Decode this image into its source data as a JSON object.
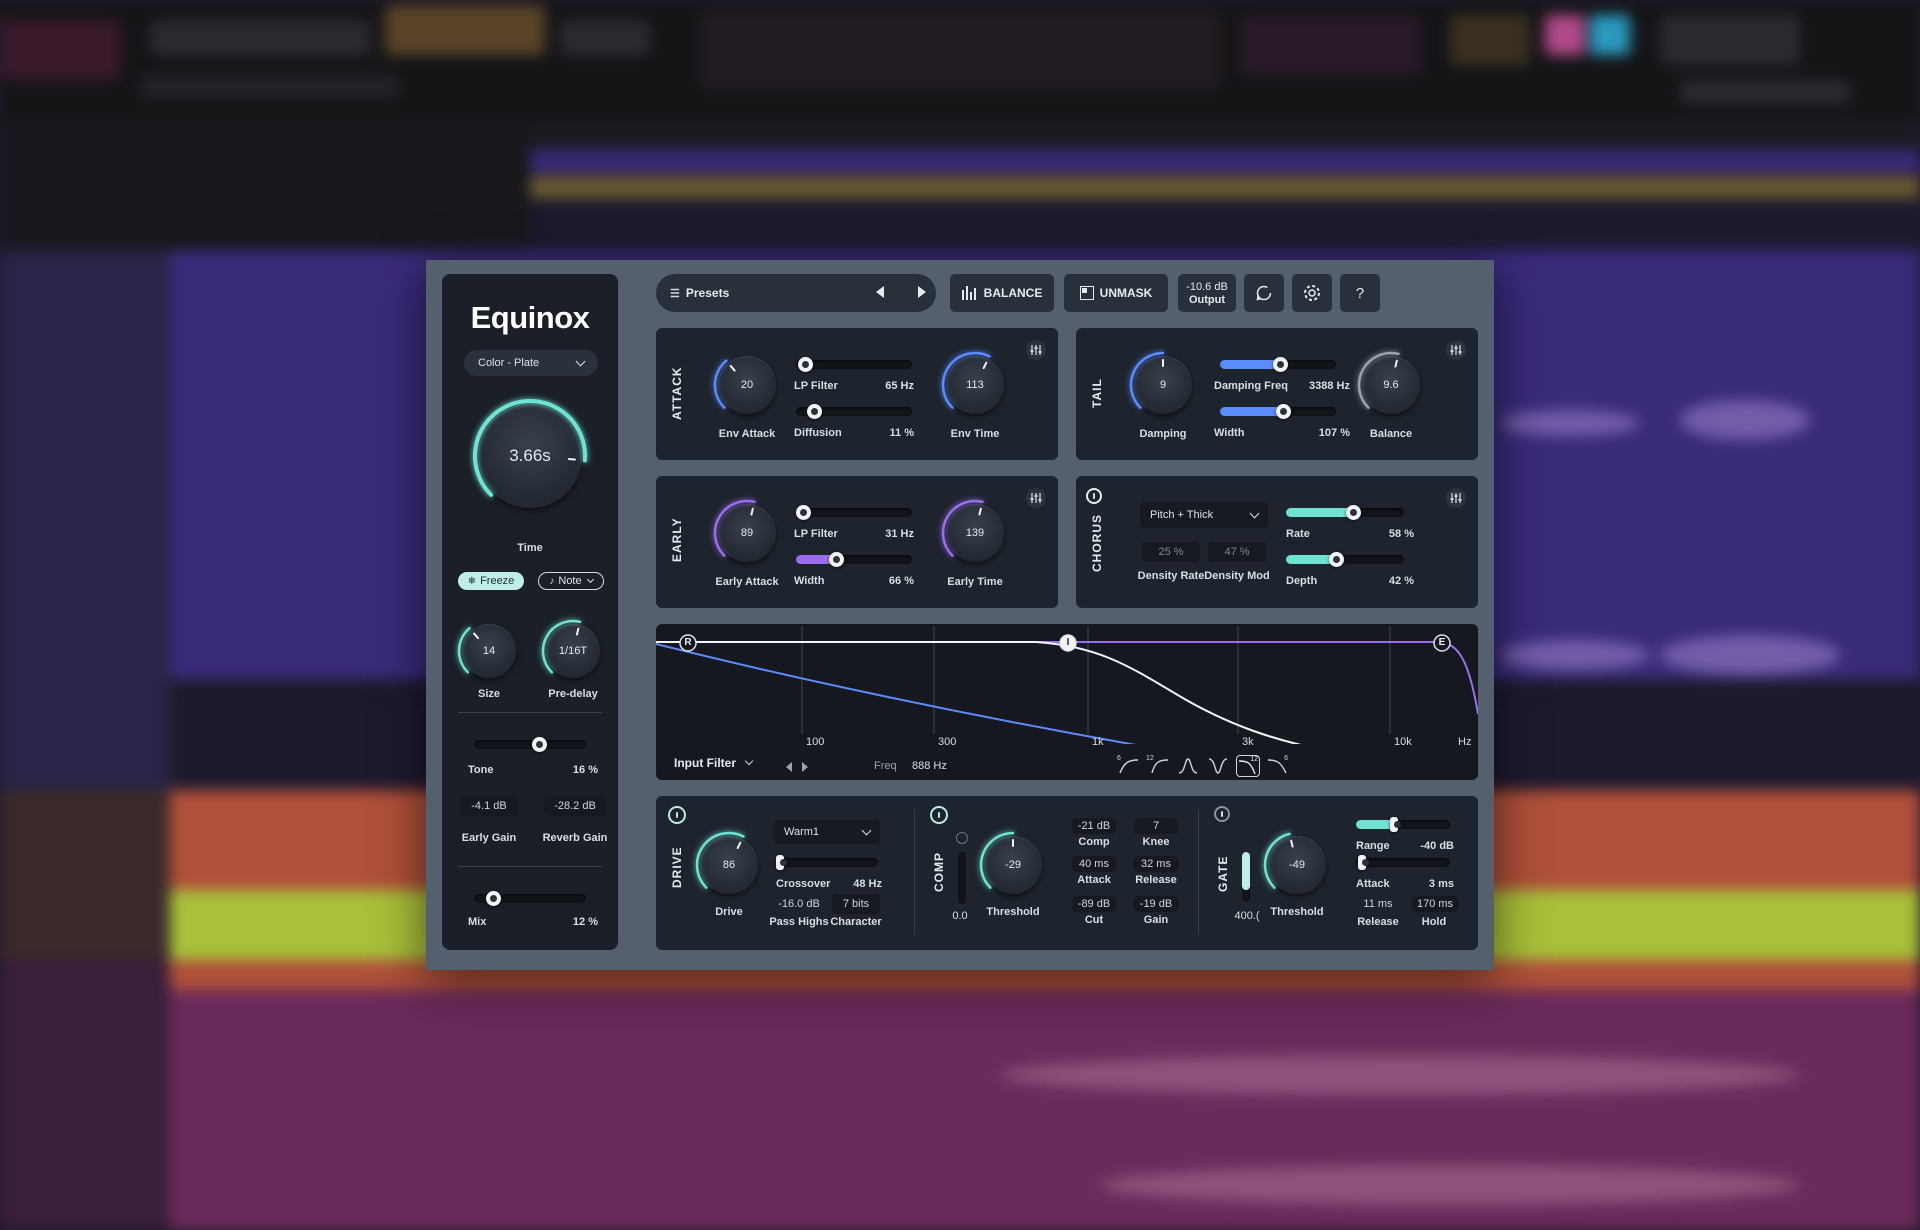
{
  "plugin": {
    "brand": "Equinox",
    "colors": {
      "accent_teal": "#6fe3d2",
      "accent_purple": "#9a6cf0",
      "accent_blue": "#5b8cff",
      "panel": "#1e242d"
    },
    "left": {
      "preset_type": "Color - Plate",
      "time": {
        "value": "3.66s",
        "label": "Time",
        "level": 0.85
      },
      "freeze_label": "Freeze",
      "note_label": "Note",
      "size": {
        "value": "14",
        "label": "Size",
        "level": 0.35
      },
      "predelay": {
        "value": "1/16T",
        "label": "Pre-delay",
        "level": 0.55
      },
      "tone": {
        "label": "Tone",
        "value": "16 %",
        "level": 0.6
      },
      "early_gain": {
        "value": "-4.1 dB",
        "label": "Early Gain"
      },
      "reverb_gain": {
        "value": "-28.2 dB",
        "label": "Reverb Gain"
      },
      "mix": {
        "label": "Mix",
        "value": "12 %",
        "level": 0.12
      }
    },
    "toolbar": {
      "presets_label": "Presets",
      "balance_label": "BALANCE",
      "unmask_label": "UNMASK",
      "output_value": "-10.6 dB",
      "output_label": "Output"
    },
    "attack": {
      "title": "ATTACK",
      "env_attack": {
        "value": "20",
        "label": "Env Attack",
        "level": 0.35
      },
      "lp_filter": {
        "label": "LP Filter",
        "value": "65 Hz",
        "level": 0.02
      },
      "diffusion": {
        "label": "Diffusion",
        "value": "11 %",
        "level": 0.11
      },
      "env_time": {
        "value": "113",
        "label": "Env Time",
        "level": 0.6
      }
    },
    "tail": {
      "title": "TAIL",
      "damping": {
        "value": "9",
        "label": "Damping",
        "level": 0.5
      },
      "damping_freq": {
        "label": "Damping Freq",
        "value": "3388 Hz",
        "level": 0.52
      },
      "width": {
        "label": "Width",
        "value": "107 %",
        "level": 0.55
      },
      "balance": {
        "value": "9.6",
        "label": "Balance",
        "level": 0.55
      }
    },
    "early": {
      "title": "EARLY",
      "early_attack": {
        "value": "89",
        "label": "Early Attack",
        "level": 0.55
      },
      "lp_filter": {
        "label": "LP Filter",
        "value": "31 Hz",
        "level": 0.0
      },
      "width": {
        "label": "Width",
        "value": "66 %",
        "level": 0.33
      },
      "early_time": {
        "value": "139",
        "label": "Early Time",
        "level": 0.55
      }
    },
    "chorus": {
      "title": "CHORUS",
      "mode": "Pitch + Thick",
      "density_rate": {
        "value": "25 %",
        "label": "Density Rate"
      },
      "density_mod": {
        "value": "47 %",
        "label": "Density Mod"
      },
      "rate": {
        "label": "Rate",
        "value": "58 %",
        "level": 0.58
      },
      "depth": {
        "label": "Depth",
        "value": "42 %",
        "level": 0.42
      }
    },
    "filter": {
      "nodes": [
        "R",
        "I",
        "E"
      ],
      "freq_ticks": [
        "100",
        "300",
        "1k",
        "3k",
        "10k",
        "Hz"
      ],
      "selector": "Input Filter",
      "freq_label": "Freq",
      "freq_value": "888 Hz",
      "shape_icons": [
        "6",
        "12",
        "",
        "",
        "12",
        "6"
      ]
    },
    "drive": {
      "title": "DRIVE",
      "drive": {
        "value": "86",
        "label": "Drive",
        "level": 0.6
      },
      "mode": "Warm1",
      "crossover": {
        "label": "Crossover",
        "value": "48 Hz",
        "level": 0.0
      },
      "pass_highs": {
        "value": "-16.0 dB",
        "label": "Pass Highs"
      },
      "character": {
        "value": "7 bits",
        "label": "Character"
      }
    },
    "comp": {
      "title": "COMP",
      "meter_value": "0.0",
      "threshold": {
        "value": "-29",
        "label": "Threshold",
        "level": 0.5
      },
      "comp": {
        "value": "-21 dB",
        "label": "Comp"
      },
      "knee": {
        "value": "7",
        "label": "Knee"
      },
      "attack": {
        "value": "40 ms",
        "label": "Attack"
      },
      "release": {
        "value": "32 ms",
        "label": "Release"
      },
      "cut": {
        "value": "-89 dB",
        "label": "Cut"
      },
      "gain": {
        "value": "-19 dB",
        "label": "Gain"
      }
    },
    "gate": {
      "title": "GATE",
      "meter_value": "400.(",
      "threshold": {
        "value": "-49",
        "label": "Threshold",
        "level": 0.45
      },
      "range": {
        "label": "Range",
        "value": "-40 dB",
        "level": 0.4
      },
      "attack": {
        "label": "Attack",
        "value": "3 ms",
        "level": 0.02
      },
      "release": {
        "value": "11 ms",
        "label": "Release"
      },
      "hold": {
        "value": "170 ms",
        "label": "Hold"
      }
    }
  }
}
